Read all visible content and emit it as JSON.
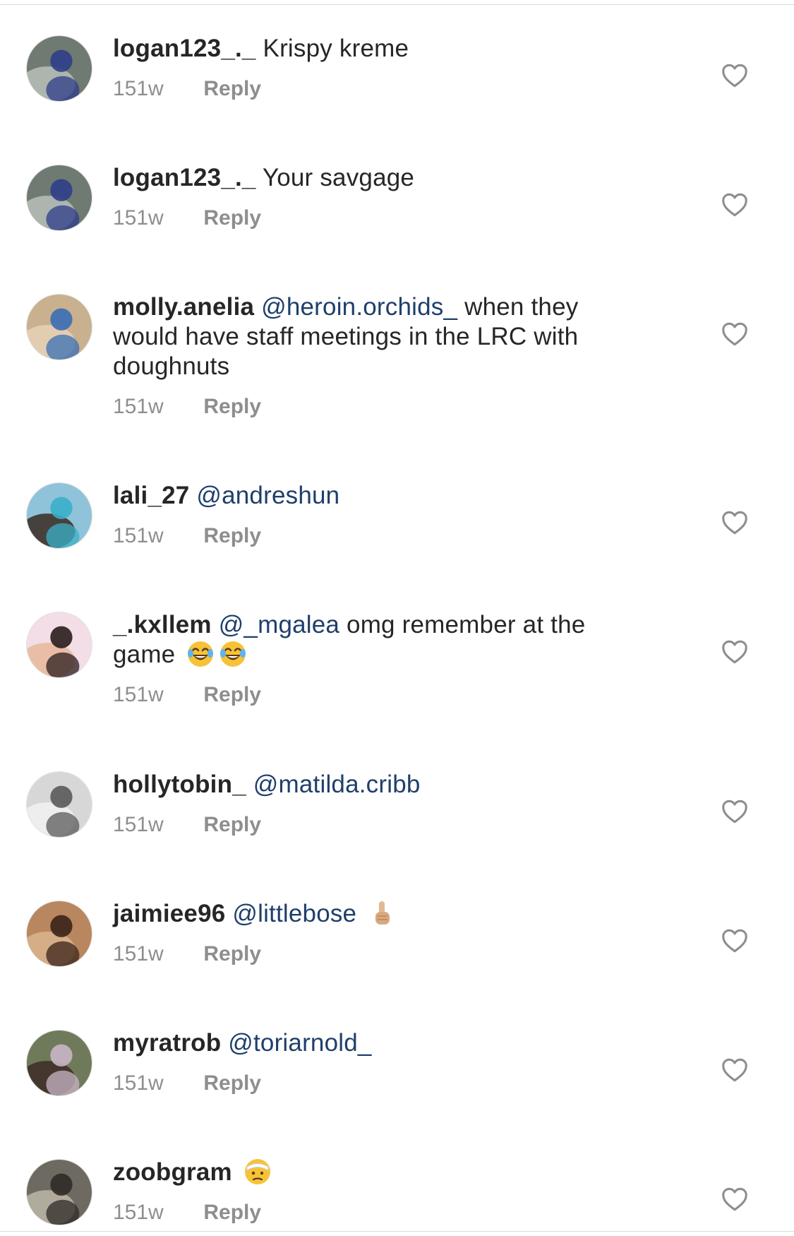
{
  "comments": [
    {
      "username": "logan123_._",
      "mention": "",
      "text": "Krispy kreme",
      "emoji": [],
      "time": "151w",
      "reply_label": "Reply",
      "avatar_colors": [
        "#6f7a72",
        "#2f3e8a",
        "#b9c0b8"
      ]
    },
    {
      "username": "logan123_._",
      "mention": "",
      "text": "Your savgage",
      "emoji": [],
      "time": "151w",
      "reply_label": "Reply",
      "avatar_colors": [
        "#6f7a72",
        "#2f3e8a",
        "#b9c0b8"
      ]
    },
    {
      "username": "molly.anelia",
      "mention": "@heroin.orchids_",
      "text": "when they would have staff meetings in the LRC with doughnuts",
      "emoji": [],
      "time": "151w",
      "reply_label": "Reply",
      "avatar_colors": [
        "#c9b08e",
        "#3a6fb5",
        "#e7d2b7"
      ]
    },
    {
      "username": "lali_27",
      "mention": "@andreshun",
      "text": "",
      "emoji": [],
      "time": "151w",
      "reply_label": "Reply",
      "avatar_colors": [
        "#8fc3d9",
        "#3ab0c8",
        "#3b2a22"
      ]
    },
    {
      "username": "_.kxllem",
      "mention": "@_mgalea",
      "text": "omg remember at the game",
      "emoji": [
        "tears-of-joy-emoji",
        "tears-of-joy-emoji"
      ],
      "time": "151w",
      "reply_label": "Reply",
      "avatar_colors": [
        "#f3dde6",
        "#2a1d1d",
        "#e8b79a"
      ]
    },
    {
      "username": "hollytobin_",
      "mention": "@matilda.cribb",
      "text": "",
      "emoji": [],
      "time": "151w",
      "reply_label": "Reply",
      "avatar_colors": [
        "#d7d7d7",
        "#5a5a5a",
        "#f2f2f2"
      ]
    },
    {
      "username": "jaimiee96",
      "mention": "@littlebose",
      "text": "",
      "emoji": [
        "index-pointing-up-emoji"
      ],
      "time": "151w",
      "reply_label": "Reply",
      "avatar_colors": [
        "#b8875f",
        "#3b241a",
        "#d9b48e"
      ]
    },
    {
      "username": "myratrob",
      "mention": "@toriarnold_",
      "text": "",
      "emoji": [],
      "time": "151w",
      "reply_label": "Reply",
      "avatar_colors": [
        "#6f7a5b",
        "#c8b6c7",
        "#3d2b26"
      ]
    },
    {
      "username": "zoobgram",
      "mention": "",
      "text": "",
      "emoji": [
        "bandage-face-emoji"
      ],
      "time": "151w",
      "reply_label": "Reply",
      "avatar_colors": [
        "#6e6a62",
        "#2f2b27",
        "#bdb6a8"
      ]
    }
  ],
  "colors": {
    "text": "#262626",
    "mention": "#1f3f6b",
    "meta": "#8e8e8e",
    "heart_stroke": "#8e8e8e",
    "divider": "#dbdbdb"
  }
}
